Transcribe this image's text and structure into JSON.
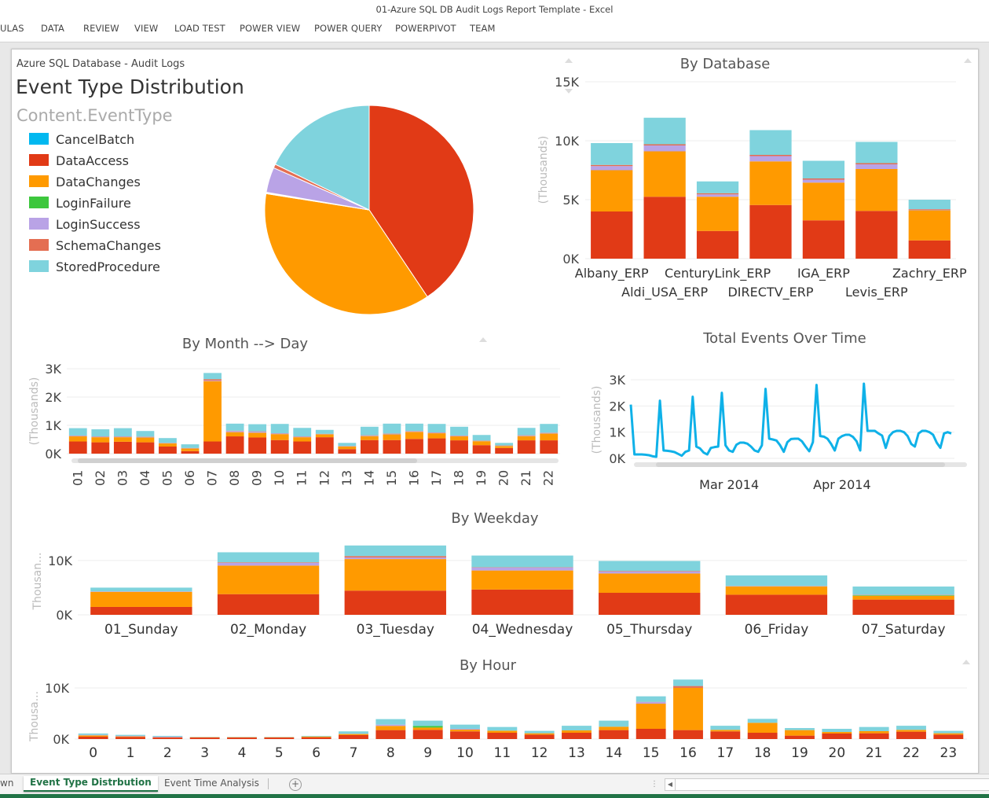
{
  "window": {
    "title": "01-Azure SQL DB Audit Logs Report Template - Excel"
  },
  "ribbon": {
    "tabs": [
      "ULAS",
      "DATA",
      "REVIEW",
      "VIEW",
      "LOAD TEST",
      "POWER VIEW",
      "POWER QUERY",
      "POWERPIVOT",
      "TEAM"
    ]
  },
  "report": {
    "subtitle": "Azure SQL Database - Audit Logs",
    "title": "Event Type Distribution",
    "legend_title": "Content.EventType"
  },
  "colors": {
    "CancelBatch": "#01B8F0",
    "DataAccess": "#E13A16",
    "DataChanges": "#FF9A00",
    "LoginFailure": "#3DC73D",
    "LoginSuccess": "#B9A3E6",
    "SchemaChanges": "#E46E52",
    "StoredProcedure": "#7FD3DD",
    "line": "#0FB1E8"
  },
  "sheets": {
    "tabs": [
      "wn",
      "Event Type Distrbution",
      "Event Time Analysis"
    ],
    "active": "Event Type Distrbution",
    "add_label": "+"
  },
  "chart_data": [
    {
      "id": "pie",
      "type": "pie",
      "title": "Event Type Distribution",
      "legend_title": "Content.EventType",
      "legend_position": "left",
      "labels": [
        "CancelBatch",
        "DataAccess",
        "DataChanges",
        "LoginFailure",
        "LoginSuccess",
        "SchemaChanges",
        "StoredProcedure"
      ],
      "values": [
        0.1,
        40.6,
        36.9,
        0.1,
        3.9,
        0.6,
        17.8
      ]
    },
    {
      "id": "by_database",
      "type": "bar",
      "stacked": true,
      "title": "By Database",
      "ylabel": "(Thousands)",
      "ylim": [
        0,
        15
      ],
      "yticks": [
        "0K",
        "5K",
        "10K",
        "15K"
      ],
      "ytick_values": [
        0,
        5,
        10,
        15
      ],
      "categories": [
        "Albany_ERP",
        "Aldi_USA_ERP",
        "CenturyLink_ERP",
        "DIRECTV_ERP",
        "IGA_ERP",
        "Levis_ERP",
        "Zachry_ERP"
      ],
      "series": [
        {
          "name": "DataAccess",
          "values": [
            4.0,
            5.25,
            2.35,
            4.55,
            3.25,
            4.05,
            1.55
          ]
        },
        {
          "name": "DataChanges",
          "values": [
            3.5,
            3.85,
            2.9,
            3.7,
            3.2,
            3.55,
            2.55
          ]
        },
        {
          "name": "LoginSuccess",
          "values": [
            0.35,
            0.5,
            0.2,
            0.45,
            0.25,
            0.4,
            0.05
          ]
        },
        {
          "name": "SchemaChanges",
          "values": [
            0.1,
            0.1,
            0.1,
            0.1,
            0.1,
            0.1,
            0.05
          ]
        },
        {
          "name": "StoredProcedure",
          "values": [
            1.85,
            2.25,
            1.0,
            2.1,
            1.5,
            1.8,
            0.8
          ]
        }
      ]
    },
    {
      "id": "by_month_day",
      "type": "bar",
      "stacked": true,
      "title": "By Month --> Day",
      "ylabel": "(Thousands)",
      "ylim": [
        0,
        3
      ],
      "yticks": [
        "0K",
        "1K",
        "2K",
        "3K"
      ],
      "ytick_values": [
        0,
        1,
        2,
        3
      ],
      "categories": [
        "01",
        "02",
        "03",
        "04",
        "05",
        "06",
        "07",
        "08",
        "09",
        "10",
        "11",
        "12",
        "13",
        "14",
        "15",
        "16",
        "17",
        "18",
        "19",
        "20",
        "21",
        "22"
      ],
      "series": [
        {
          "name": "DataAccess",
          "values": [
            0.43,
            0.4,
            0.42,
            0.4,
            0.25,
            0.09,
            0.43,
            0.61,
            0.57,
            0.48,
            0.43,
            0.58,
            0.16,
            0.48,
            0.48,
            0.52,
            0.54,
            0.47,
            0.3,
            0.2,
            0.47,
            0.47
          ]
        },
        {
          "name": "DataChanges",
          "values": [
            0.18,
            0.18,
            0.16,
            0.17,
            0.11,
            0.09,
            2.13,
            0.15,
            0.17,
            0.21,
            0.15,
            0.1,
            0.09,
            0.14,
            0.2,
            0.25,
            0.18,
            0.14,
            0.14,
            0.07,
            0.15,
            0.24
          ]
        },
        {
          "name": "LoginSuccess",
          "values": [
            0.02,
            0.02,
            0.02,
            0.02,
            0.01,
            0.01,
            0.02,
            0.04,
            0.04,
            0.02,
            0.02,
            0.01,
            0.01,
            0.02,
            0.02,
            0.02,
            0.02,
            0.02,
            0.01,
            0.01,
            0.02,
            0.02
          ]
        },
        {
          "name": "SchemaChanges",
          "values": [
            0.01,
            0.01,
            0.01,
            0.01,
            0.01,
            0.01,
            0.05,
            0.01,
            0.01,
            0.01,
            0.01,
            0.01,
            0.01,
            0.01,
            0.01,
            0.01,
            0.01,
            0.01,
            0.01,
            0.01,
            0.01,
            0.01
          ]
        },
        {
          "name": "StoredProcedure",
          "values": [
            0.26,
            0.25,
            0.29,
            0.2,
            0.17,
            0.13,
            0.22,
            0.25,
            0.25,
            0.33,
            0.3,
            0.14,
            0.11,
            0.3,
            0.35,
            0.26,
            0.3,
            0.31,
            0.2,
            0.09,
            0.26,
            0.31
          ]
        }
      ]
    },
    {
      "id": "total_events",
      "type": "line",
      "title": "Total Events Over Time",
      "ylabel": "(Thousands)",
      "ylim": [
        0,
        3
      ],
      "yticks": [
        "0K",
        "1K",
        "2K",
        "3K"
      ],
      "ytick_values": [
        0,
        1,
        2,
        3
      ],
      "x_start": "2014-02-02",
      "x_end": "2014-04-30",
      "xticks": [
        "Mar 2014",
        "Apr 2014"
      ],
      "xtick_day_index": [
        27,
        58
      ],
      "values": [
        2.05,
        0.15,
        0.15,
        0.15,
        0.14,
        0.12,
        0.08,
        0.06,
        2.2,
        0.3,
        0.29,
        0.27,
        0.24,
        0.17,
        0.1,
        0.25,
        0.3,
        2.35,
        0.45,
        0.38,
        0.22,
        0.15,
        0.4,
        0.43,
        0.45,
        2.5,
        0.5,
        0.3,
        0.25,
        0.52,
        0.6,
        0.6,
        0.56,
        0.45,
        0.3,
        0.25,
        0.5,
        2.65,
        0.75,
        0.72,
        0.68,
        0.5,
        0.25,
        0.62,
        0.74,
        0.75,
        0.75,
        0.65,
        0.45,
        0.27,
        0.62,
        2.8,
        0.85,
        0.83,
        0.75,
        0.55,
        0.3,
        0.75,
        0.85,
        0.9,
        0.9,
        0.82,
        0.65,
        0.3,
        2.85,
        1.05,
        1.05,
        1.05,
        0.95,
        0.87,
        0.4,
        0.85,
        1.0,
        1.05,
        1.05,
        1.0,
        0.85,
        0.55,
        0.45,
        0.95,
        1.05,
        1.05,
        1.0,
        0.9,
        0.6,
        0.4,
        0.95,
        1.0,
        0.95
      ]
    },
    {
      "id": "by_weekday",
      "type": "bar",
      "stacked": true,
      "title": "By Weekday",
      "ylabel": "Thousan...",
      "ylim": [
        0,
        12
      ],
      "yticks": [
        "0K",
        "10K"
      ],
      "ytick_values": [
        0,
        10
      ],
      "categories": [
        "01_Sunday",
        "02_Monday",
        "03_Tuesday",
        "04_Wednesday",
        "05_Thursday",
        "06_Friday",
        "07_Saturday"
      ],
      "series": [
        {
          "name": "DataAccess",
          "values": [
            1.45,
            3.8,
            4.45,
            4.65,
            4.05,
            3.7,
            2.8
          ]
        },
        {
          "name": "DataChanges",
          "values": [
            2.75,
            5.25,
            5.8,
            3.5,
            3.55,
            1.5,
            0.7
          ]
        },
        {
          "name": "LoginFailure",
          "values": [
            0,
            0,
            0,
            0,
            0,
            0,
            0.1
          ]
        },
        {
          "name": "LoginSuccess",
          "values": [
            0.05,
            0.5,
            0.3,
            0.55,
            0.35,
            0.05,
            0.05
          ]
        },
        {
          "name": "SchemaChanges",
          "values": [
            0.05,
            0.1,
            0.25,
            0.05,
            0.1,
            0.05,
            0.05
          ]
        },
        {
          "name": "StoredProcedure",
          "values": [
            0.7,
            1.85,
            1.95,
            2.15,
            1.85,
            1.95,
            1.5
          ]
        }
      ]
    },
    {
      "id": "by_hour",
      "type": "bar",
      "stacked": true,
      "title": "By Hour",
      "ylabel": "Thousa...",
      "ylim": [
        0,
        10
      ],
      "yticks": [
        "0K",
        "10K"
      ],
      "ytick_values": [
        0,
        10
      ],
      "categories": [
        "0",
        "1",
        "2",
        "3",
        "4",
        "5",
        "6",
        "7",
        "8",
        "9",
        "10",
        "11",
        "12",
        "13",
        "14",
        "15",
        "16",
        "17",
        "18",
        "19",
        "20",
        "21",
        "22",
        "23"
      ],
      "series": [
        {
          "name": "DataAccess",
          "values": [
            0.46,
            0.4,
            0.3,
            0.3,
            0.3,
            0.3,
            0.35,
            0.77,
            1.75,
            1.8,
            1.5,
            1.23,
            0.87,
            1.23,
            1.75,
            2.0,
            1.75,
            1.5,
            1.23,
            0.67,
            1.08,
            1.13,
            1.44,
            0.87
          ]
        },
        {
          "name": "DataChanges",
          "values": [
            0.26,
            0.12,
            0.05,
            0.06,
            0.06,
            0.06,
            0.15,
            0.2,
            0.82,
            0.45,
            0.35,
            0.41,
            0.26,
            0.46,
            0.66,
            4.92,
            8.26,
            0.3,
            1.95,
            1.08,
            0.3,
            0.41,
            0.36,
            0.26
          ]
        },
        {
          "name": "LoginFailure",
          "values": [
            0,
            0,
            0,
            0,
            0,
            0,
            0,
            0,
            0,
            0.3,
            0,
            0,
            0,
            0,
            0,
            0,
            0,
            0,
            0,
            0,
            0,
            0,
            0,
            0
          ]
        },
        {
          "name": "LoginSuccess",
          "values": [
            0.1,
            0.1,
            0.12,
            0,
            0,
            0,
            0,
            0,
            0.25,
            0,
            0.15,
            0,
            0,
            0,
            0,
            0.3,
            0,
            0,
            0,
            0,
            0,
            0,
            0,
            0
          ]
        },
        {
          "name": "SchemaChanges",
          "values": [
            0,
            0,
            0,
            0,
            0,
            0,
            0,
            0.05,
            0,
            0,
            0,
            0,
            0,
            0,
            0,
            0.05,
            0.36,
            0,
            0,
            0,
            0,
            0,
            0,
            0
          ]
        },
        {
          "name": "StoredProcedure",
          "values": [
            0.26,
            0.2,
            0.15,
            0.05,
            0.05,
            0.05,
            0.12,
            0.48,
            1.08,
            1.05,
            0.82,
            0.72,
            0.47,
            0.91,
            1.19,
            1.09,
            1.27,
            0.8,
            0.77,
            0.4,
            0.62,
            0.82,
            0.8,
            0.47
          ]
        }
      ]
    }
  ]
}
